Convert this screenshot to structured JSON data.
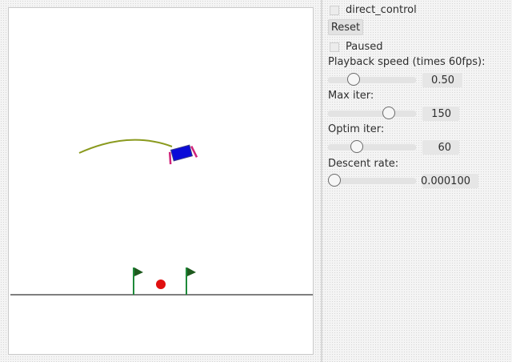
{
  "controls": {
    "direct_control_label": "direct_control",
    "direct_control_checked": false,
    "reset_label": "Reset",
    "paused_label": "Paused",
    "paused_checked": false,
    "playback_speed": {
      "label": "Playback speed (times 60fps):",
      "value": "0.50",
      "fraction": 0.25
    },
    "max_iter": {
      "label": "Max iter:",
      "value": "150",
      "fraction": 0.72
    },
    "optim_iter": {
      "label": "Optim iter:",
      "value": "60",
      "fraction": 0.3
    },
    "descent_rate": {
      "label": "Descent rate:",
      "value": "0.000100",
      "fraction": 0.0
    }
  },
  "scene": {
    "trajectory_color": "#8a9a1e",
    "vehicle_color": "#0b0bd8",
    "vehicle_legs_color": "#d0237a",
    "ball_color": "#e01010",
    "flag_pole_color": "#1e8a3a",
    "flag_color": "#1e5a1e",
    "ground_color": "#555555"
  }
}
